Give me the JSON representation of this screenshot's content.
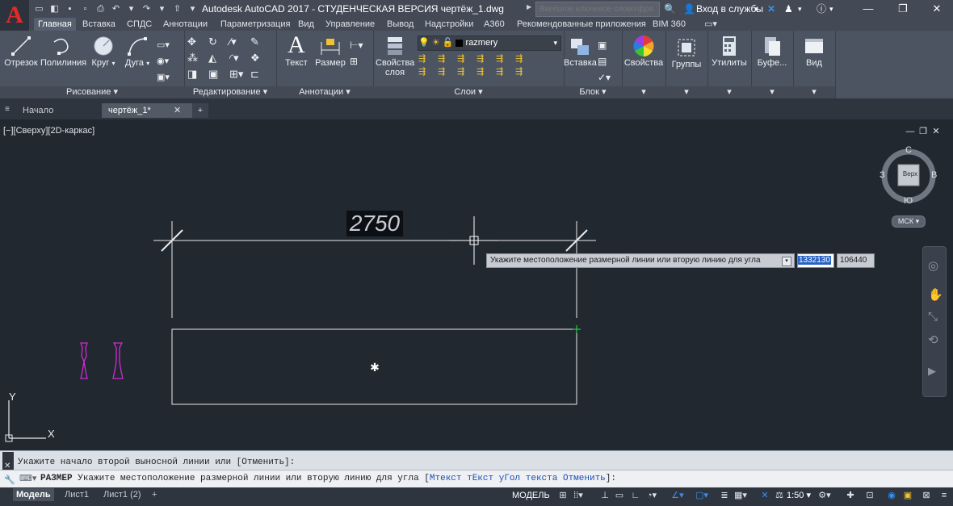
{
  "titlebar": {
    "title": "Autodesk AutoCAD 2017 - СТУДЕНЧЕСКАЯ ВЕРСИЯ    чертёж_1.dwg",
    "search_placeholder": "Введите ключевое слово/фразу",
    "login": "Вход в службы",
    "app_letter": "A"
  },
  "ribbon_tabs": [
    "Главная",
    "Вставка",
    "СПДС",
    "Аннотации",
    "Параметризация",
    "Вид",
    "Управление",
    "Вывод",
    "Надстройки",
    "A360",
    "Рекомендованные приложения",
    "BIM 360"
  ],
  "panels": {
    "draw": {
      "title": "Рисование",
      "buttons": [
        "Отрезок",
        "Полилиния",
        "Круг",
        "Дуга"
      ]
    },
    "modify": {
      "title": "Редактирование"
    },
    "annotation": {
      "title": "Аннотации",
      "buttons": [
        "Текст",
        "Размер"
      ]
    },
    "layers": {
      "title": "Слои",
      "layer_props": "Свойства слоя",
      "current_layer": "razmery"
    },
    "block": {
      "title": "Блок",
      "insert": "Вставка"
    },
    "properties": {
      "label": "Свойства"
    },
    "groups": {
      "label": "Группы"
    },
    "utilities": {
      "label": "Утилиты"
    },
    "clipboard": {
      "label": "Буфе..."
    },
    "view": {
      "label": "Вид"
    }
  },
  "doc_tabs": [
    {
      "label": "Начало"
    },
    {
      "label": "чертёж_1*"
    }
  ],
  "viewport_label": "[−][Сверху][2D-каркас]",
  "drawing": {
    "dimension_text": "2750",
    "prompt": "Укажите местоположение размерной линии или вторую линию для угла",
    "coord1": "1332130",
    "coord2": "106440",
    "axis_y": "Y",
    "axis_x": "X"
  },
  "viewcube": {
    "n": "С",
    "s": "Ю",
    "e": "В",
    "w": "З",
    "face": "Верх",
    "ucs": "МСК"
  },
  "command": {
    "history": "Укажите начало второй выносной линии или [Отменить]:",
    "prefix": "РАЗМЕР",
    "prompt": "Укажите местоположение размерной линии или вторую линию для угла [",
    "opt1": "Мтекст",
    "opt2": "тЕкст",
    "opt3": "уГол текста",
    "opt4": "Отменить",
    "suffix": "]:"
  },
  "status": {
    "layout_tabs": [
      "Модель",
      "Лист1",
      "Лист1 (2)"
    ],
    "model": "МОДЕЛЬ",
    "scale": "1:50"
  },
  "colors": {
    "accent": "#e22b2b",
    "canvas": "#212830",
    "magenta": "#d12bd1"
  }
}
